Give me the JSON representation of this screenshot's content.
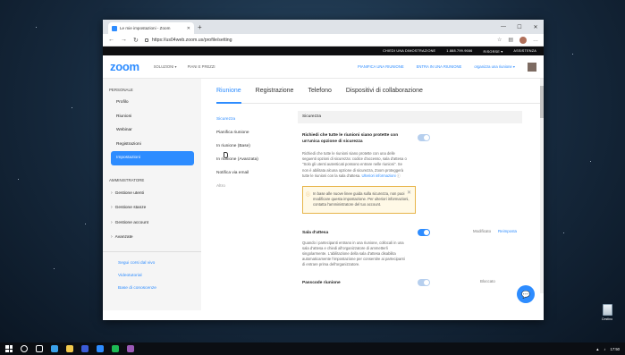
{
  "browser": {
    "tab_title": "Le mie impostazioni - Zoom",
    "url": "https://us04web.zoom.us/profile/setting"
  },
  "topbar": {
    "demo": "CHIEDI UNA DIMOSTRAZIONE",
    "phone": "1.888.799.9666",
    "resources": "RISORSE ▾",
    "support": "ASSISTENZA"
  },
  "zoomnav": {
    "logo": "zoom",
    "solutions": "SOLUZIONI ▾",
    "plans": "PIANI E PREZZI",
    "schedule": "PIANIFICA UNA RIUNIONE",
    "join": "ENTRA IN UNA RIUNIONE",
    "host": "organizza una riunione ▾"
  },
  "sidebar": {
    "personal_header": "PERSONALE",
    "items": [
      "Profilo",
      "Riunioni",
      "Webinar",
      "Registrazioni",
      "Impostazioni"
    ],
    "admin_header": "AMMINISTRATORE",
    "admin_items": [
      "Gestione utenti",
      "Gestione stanze",
      "Gestione account",
      "Avanzate"
    ],
    "bottom_links": [
      "Segui corsi dal vivo",
      "Videotutorial",
      "Base di conoscenze"
    ]
  },
  "tabs": [
    "Riunione",
    "Registrazione",
    "Telefono",
    "Dispositivi di collaborazione"
  ],
  "subnav": [
    "Sicurezza",
    "Pianifica riunione",
    "In riunione (Base)",
    "In riunione (Avanzata)",
    "Notifica via email",
    "Altro"
  ],
  "panel": {
    "header": "Sicurezza",
    "s1_title": "Richiedi che tutte le riunioni siano protette con un'unica opzione di sicurezza",
    "s1_desc": "Richiedi che tutte le riunioni siano protette con una delle seguenti opzioni di sicurezza: codice d'accesso, sala d'attesa o \"Solo gli utenti autenticati possono entrare nelle riunioni\". Se non è abilitata alcuna opzione di sicurezza, Zoom proteggerà tutte le riunioni con la sala d'attesa.",
    "s1_link": "Ulteriori informazioni",
    "notice": "In base alle nuove linee guida sulla sicurezza, non puoi modificare questa impostazione. Per ulteriori informazioni, contatta l'amministratore del tuo account.",
    "s2_title": "Sala d'attesa",
    "s2_desc": "Quando i partecipanti entrano in una riunione, collocali in una sala d'attesa e chiedi all'organizzatore di ammetterli singolarmente. L'abilitazione della sala d'attesa disabilita automaticamente l'impostazione per consentire ai partecipanti di entrare prima dell'organizzatore.",
    "modified": "Modificato",
    "reset": "Reimposta",
    "s3_title": "Passcode riunione",
    "locked": "Bloccato"
  },
  "desktop": {
    "recycle_label": "Cestino",
    "time": "17:50"
  }
}
